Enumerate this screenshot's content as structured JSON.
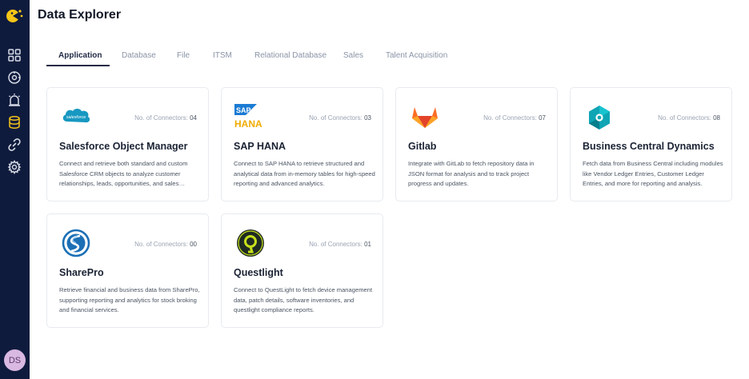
{
  "header": {
    "title": "Data Explorer"
  },
  "user": {
    "initials": "DS"
  },
  "sidebar": {
    "items": [
      {
        "icon": "dashboard-icon"
      },
      {
        "icon": "compass-icon"
      },
      {
        "icon": "alarm-icon"
      },
      {
        "icon": "database-icon",
        "active": true
      },
      {
        "icon": "link-icon"
      },
      {
        "icon": "gear-icon"
      }
    ]
  },
  "tabs": [
    {
      "label": "Application",
      "active": true
    },
    {
      "label": "Database"
    },
    {
      "label": "File"
    },
    {
      "label": "ITSM"
    },
    {
      "label": "Relational Database"
    },
    {
      "label": "Sales"
    },
    {
      "label": "Talent Acquisition"
    }
  ],
  "connector_label": "No. of Connectors:",
  "cards": [
    {
      "title": "Salesforce Object Manager",
      "count": "04",
      "logo": "salesforce-logo",
      "description": "Connect and retrieve both standard and custom Salesforce CRM objects to analyze customer relationships, leads, opportunities, and sales performance."
    },
    {
      "title": "SAP HANA",
      "count": "03",
      "logo": "sap-hana-logo",
      "logo_text_1": "SAP",
      "logo_text_2": "HANA",
      "description": "Connect to SAP HANA to retrieve structured and analytical data from in-memory tables for high-speed reporting and advanced analytics."
    },
    {
      "title": "Gitlab",
      "count": "07",
      "logo": "gitlab-logo",
      "description": "Integrate with GitLab to fetch repository data in JSON format for analysis and to track project progress and updates."
    },
    {
      "title": "Business Central Dynamics",
      "count": "08",
      "logo": "business-central-logo",
      "description": "Fetch data from Business Central including modules like Vendor Ledger Entries, Customer Ledger Entries, and more for reporting and analysis."
    },
    {
      "title": "SharePro",
      "count": "00",
      "logo": "sharepro-logo",
      "description": "Retrieve financial and business data from SharePro, supporting reporting and analytics for stock broking and financial services."
    },
    {
      "title": "Questlight",
      "count": "01",
      "logo": "questlight-logo",
      "description": "Connect to QuestLight to fetch device management data, patch details, software inventories, and questlight compliance reports."
    }
  ],
  "colors": {
    "sidebar": "#0f1b3d",
    "accent": "#f5c518",
    "active_tab": "#1f2a44",
    "avatar": "#d9b8e2"
  }
}
